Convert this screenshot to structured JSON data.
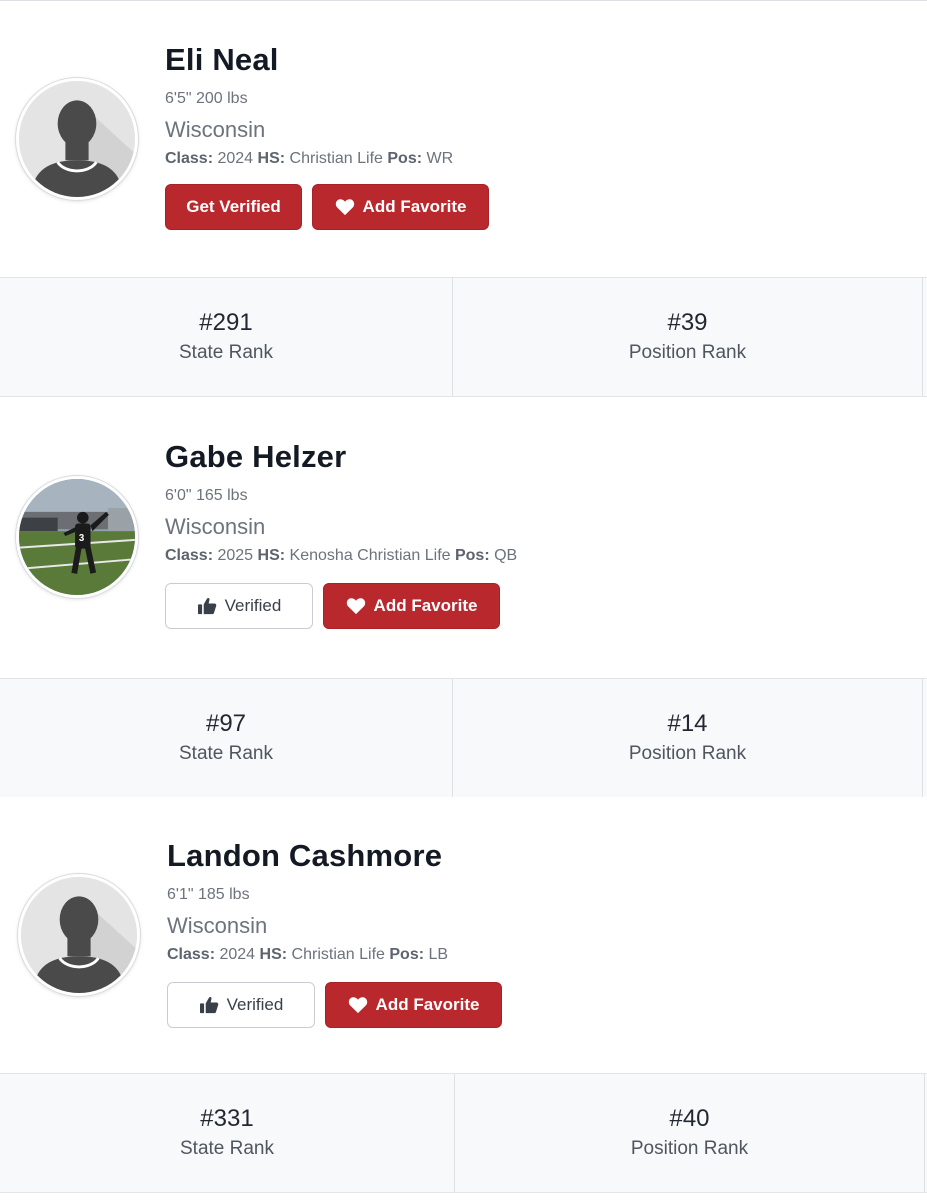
{
  "players": [
    {
      "name": "Eli Neal",
      "size": "6'5\" 200 lbs",
      "state": "Wisconsin",
      "class_label": "Class:",
      "class_value": "2024",
      "hs_label": "HS:",
      "hs_value": "Christian Life",
      "pos_label": "Pos:",
      "pos_value": "WR",
      "status_button": "Get Verified",
      "favorite_button": "Add Favorite",
      "state_rank": "#291",
      "state_rank_label": "State Rank",
      "position_rank": "#39",
      "position_rank_label": "Position Rank"
    },
    {
      "name": "Gabe Helzer",
      "size": "6'0\" 165 lbs",
      "state": "Wisconsin",
      "class_label": "Class:",
      "class_value": "2025",
      "hs_label": "HS:",
      "hs_value": "Kenosha Christian Life",
      "pos_label": "Pos:",
      "pos_value": "QB",
      "status_button": "Verified",
      "favorite_button": "Add Favorite",
      "state_rank": "#97",
      "state_rank_label": "State Rank",
      "position_rank": "#14",
      "position_rank_label": "Position Rank"
    },
    {
      "name": "Landon Cashmore",
      "size": "6'1\" 185 lbs",
      "state": "Wisconsin",
      "class_label": "Class:",
      "class_value": "2024",
      "hs_label": "HS:",
      "hs_value": "Christian Life",
      "pos_label": "Pos:",
      "pos_value": "LB",
      "status_button": "Verified",
      "favorite_button": "Add Favorite",
      "state_rank": "#331",
      "state_rank_label": "State Rank",
      "position_rank": "#40",
      "position_rank_label": "Position Rank"
    }
  ],
  "colors": {
    "accent_red": "#b8282d",
    "name_text": "#141a24",
    "muted_text": "#6c737c",
    "rank_bg": "#f8f9fa"
  },
  "icons": {
    "favorite": "heart-icon",
    "verified": "thumbs-up-icon",
    "avatar_placeholder": "default-user-silhouette-icon"
  }
}
